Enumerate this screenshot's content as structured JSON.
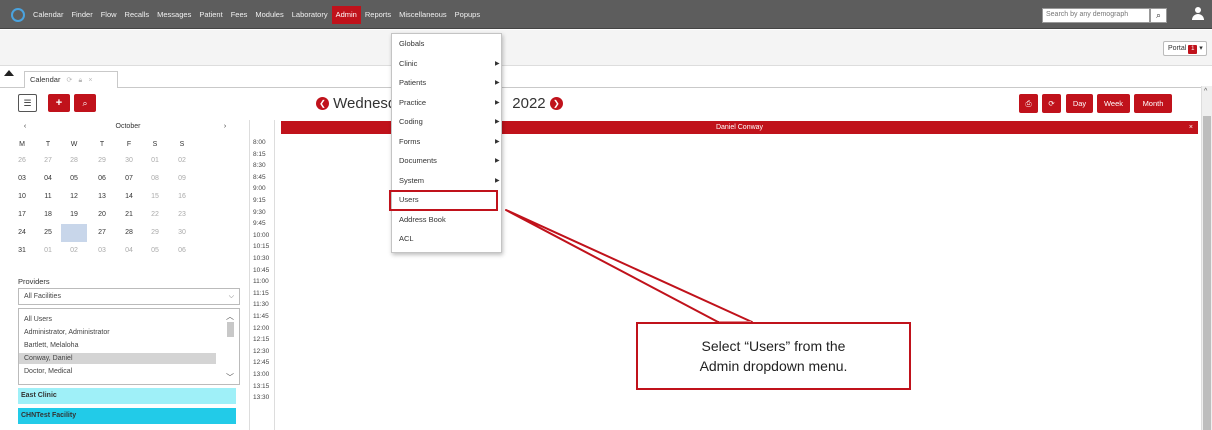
{
  "nav": {
    "items": [
      "Calendar",
      "Finder",
      "Flow",
      "Recalls",
      "Messages",
      "Patient",
      "Fees",
      "Modules",
      "Laboratory",
      "Admin",
      "Reports",
      "Miscellaneous",
      "Popups"
    ],
    "active": "Admin",
    "search_placeholder": "Search by any demograph",
    "search_icon": "search-icon",
    "user_icon": "user-icon"
  },
  "subbar": {
    "portal_label": "Portal",
    "portal_badge": "1"
  },
  "tab": {
    "label": "Calendar"
  },
  "toolbar": {
    "date_left": "Wednesd",
    "date_right": "2022",
    "print_icon": "print-icon",
    "refresh_icon": "refresh-icon",
    "day": "Day",
    "week": "Week",
    "month": "Month"
  },
  "mini_calendar": {
    "prev": "‹",
    "month": "October",
    "next": "›",
    "weekdays": [
      "M",
      "T",
      "W",
      "T",
      "F",
      "S",
      "S"
    ],
    "weeks": [
      [
        "26",
        "27",
        "28",
        "29",
        "30",
        "01",
        "02"
      ],
      [
        "03",
        "04",
        "05",
        "06",
        "07",
        "08",
        "09"
      ],
      [
        "10",
        "11",
        "12",
        "13",
        "14",
        "15",
        "16"
      ],
      [
        "17",
        "18",
        "19",
        "20",
        "21",
        "22",
        "23"
      ],
      [
        "24",
        "25",
        "26",
        "27",
        "28",
        "29",
        "30"
      ],
      [
        "31",
        "01",
        "02",
        "03",
        "04",
        "05",
        "06"
      ]
    ],
    "selected": "26"
  },
  "providers": {
    "label": "Providers",
    "facility_select": "All Facilities",
    "users": [
      "All Users",
      "Administrator, Administrator",
      "Bartlett, Melaloha",
      "Conway, Daniel",
      "Doctor, Medical"
    ],
    "selected_user": "Conway, Daniel",
    "facilities": [
      {
        "name": "East Clinic",
        "color": "#9ff0f8"
      },
      {
        "name": "CHNTest Facility",
        "color": "#22cbe8"
      }
    ]
  },
  "times": [
    "8:00",
    "8:15",
    "8:30",
    "8:45",
    "9:00",
    "9:15",
    "9:30",
    "9:45",
    "10:00",
    "10:15",
    "10:30",
    "10:45",
    "11:00",
    "11:15",
    "11:30",
    "11:45",
    "12:00",
    "12:15",
    "12:30",
    "12:45",
    "13:00",
    "13:15",
    "13:30"
  ],
  "schedule": {
    "provider": "Daniel Conway",
    "close": "×"
  },
  "admin_menu": {
    "items": [
      {
        "label": "Globals",
        "submenu": false
      },
      {
        "label": "Clinic",
        "submenu": true
      },
      {
        "label": "Patients",
        "submenu": true
      },
      {
        "label": "Practice",
        "submenu": true
      },
      {
        "label": "Coding",
        "submenu": true
      },
      {
        "label": "Forms",
        "submenu": true
      },
      {
        "label": "Documents",
        "submenu": true
      },
      {
        "label": "System",
        "submenu": true
      },
      {
        "label": "Users",
        "submenu": false
      },
      {
        "label": "Address Book",
        "submenu": false
      },
      {
        "label": "ACL",
        "submenu": false
      }
    ],
    "highlighted": "Users"
  },
  "annotation": {
    "line1": "Select “Users” from the",
    "line2": "Admin dropdown menu.",
    "color": "#c0121b"
  },
  "colors": {
    "brand": "#c0121b",
    "nav_bg": "#5d5d5d"
  }
}
